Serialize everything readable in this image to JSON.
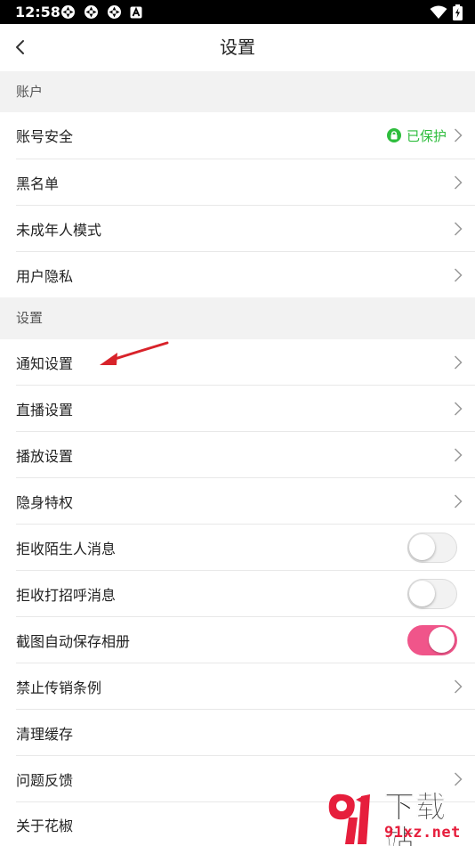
{
  "status_bar": {
    "time": "12:58",
    "icons": [
      "notification-icon",
      "notification-icon",
      "notification-icon",
      "a-letter-icon"
    ],
    "right_icons": [
      "wifi-icon",
      "battery-charging-icon"
    ]
  },
  "header": {
    "title": "设置",
    "back_icon": "chevron-left-icon"
  },
  "sections": [
    {
      "title": "账户",
      "items": [
        {
          "label": "账号安全",
          "status": "已保护",
          "status_color": "#2ebd3d",
          "chevron": true
        },
        {
          "label": "黑名单",
          "chevron": true
        },
        {
          "label": "未成年人模式",
          "chevron": true
        },
        {
          "label": "用户隐私",
          "chevron": true
        }
      ]
    },
    {
      "title": "设置",
      "items": [
        {
          "label": "通知设置",
          "chevron": true
        },
        {
          "label": "直播设置",
          "chevron": true
        },
        {
          "label": "播放设置",
          "chevron": true
        },
        {
          "label": "隐身特权",
          "chevron": true
        },
        {
          "label": "拒收陌生人消息",
          "toggle": false
        },
        {
          "label": "拒收打招呼消息",
          "toggle": false
        },
        {
          "label": "截图自动保存相册",
          "toggle": true
        },
        {
          "label": "禁止传销条例",
          "chevron": true
        },
        {
          "label": "清理缓存"
        },
        {
          "label": "问题反馈",
          "chevron": true
        },
        {
          "label": "关于花椒"
        }
      ]
    }
  ],
  "colors": {
    "accent_toggle_on": "#f0558a",
    "protected_green": "#2ebd3d",
    "annotation_arrow": "#d8232a"
  },
  "watermark": {
    "line1": "下载站",
    "line2": "91xz.net"
  }
}
